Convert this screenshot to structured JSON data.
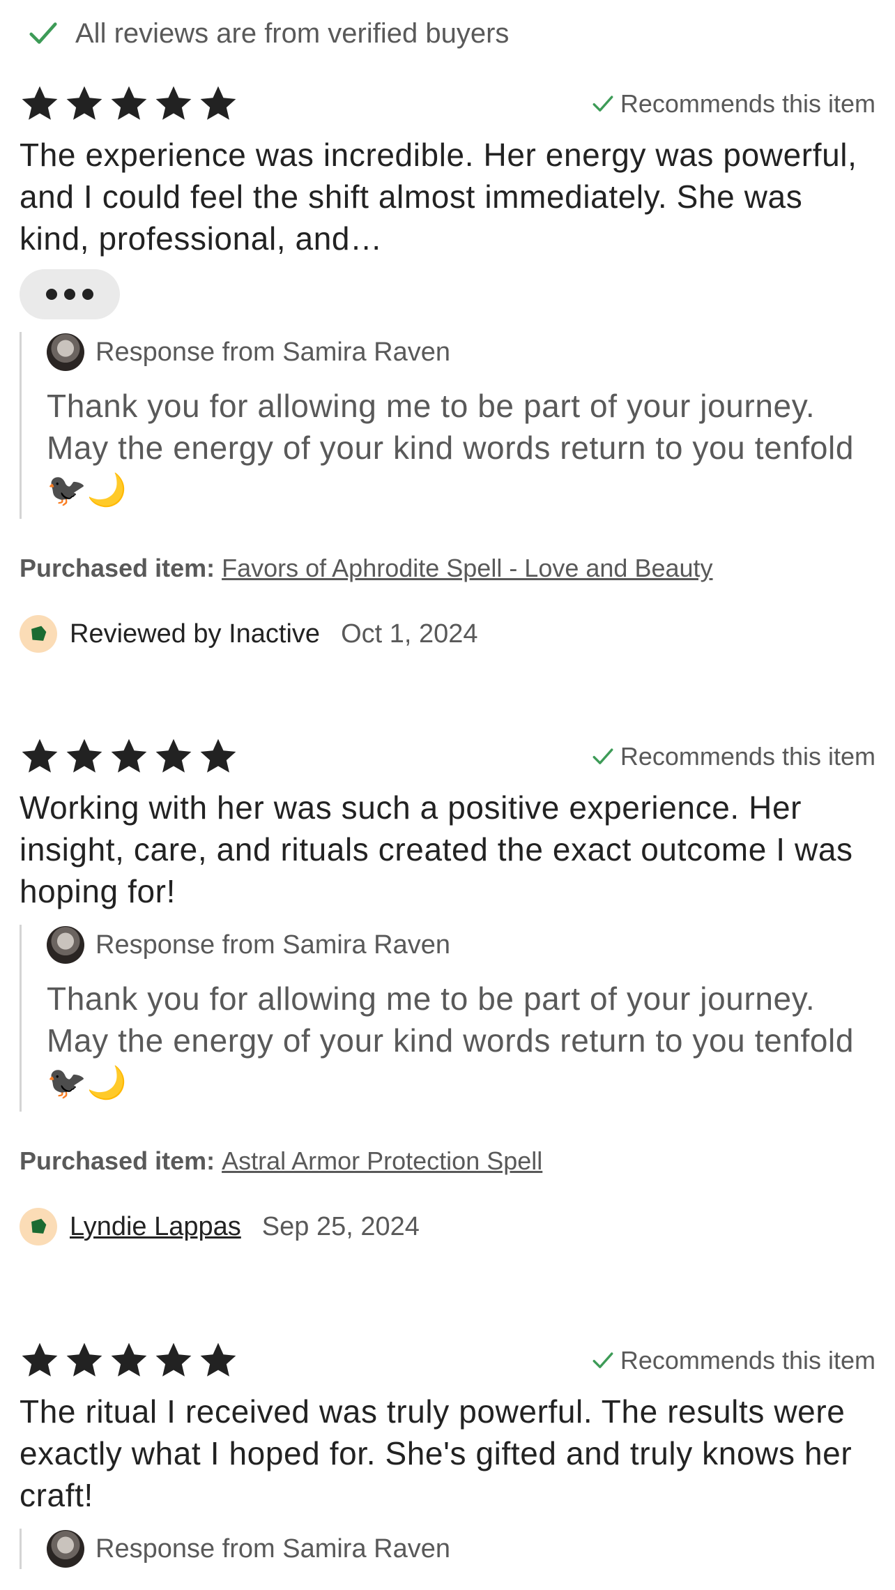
{
  "banner": {
    "text": "All reviews are from verified buyers",
    "icon": "check-icon"
  },
  "colors": {
    "check": "#3d9b57",
    "star": "#222222",
    "text": "#222222",
    "muted": "#595959",
    "reviewer_avatar_bg": "#fbdcb6",
    "reviewer_avatar_fg": "#1b6b32"
  },
  "reviews": [
    {
      "rating": 5,
      "recommends": "Recommends this item",
      "text": "The experience was incredible. Her energy was powerful, and I could feel the shift almost immediately. She was kind, professional, and…",
      "response": {
        "label": "Response from Samira Raven",
        "text": "Thank you for allowing me to be part of your journey. May the energy of your kind words return to you tenfold 🐦‍⬛🌙"
      },
      "purchased_label": "Purchased item:",
      "purchased_item": "Favors of Aphrodite Spell - Love and Beauty",
      "reviewer": "Reviewed by Inactive",
      "date": "Oct 1, 2024"
    },
    {
      "rating": 5,
      "recommends": "Recommends this item",
      "text": "Working with her was such a positive experience. Her insight, care, and rituals created the exact outcome I was hoping for!",
      "response": {
        "label": "Response from Samira Raven",
        "text": "Thank you for allowing me to be part of your journey. May the energy of your kind words return to you tenfold 🐦‍⬛🌙"
      },
      "purchased_label": "Purchased item:",
      "purchased_item": "Astral Armor Protection Spell",
      "reviewer": "Lyndie Lappas",
      "date": "Sep 25, 2024"
    },
    {
      "rating": 5,
      "recommends": "Recommends this item",
      "text": "The ritual I received was truly powerful. The results were exactly what I hoped for. She's gifted and truly knows her craft!",
      "response": {
        "label": "Response from Samira Raven"
      }
    }
  ]
}
